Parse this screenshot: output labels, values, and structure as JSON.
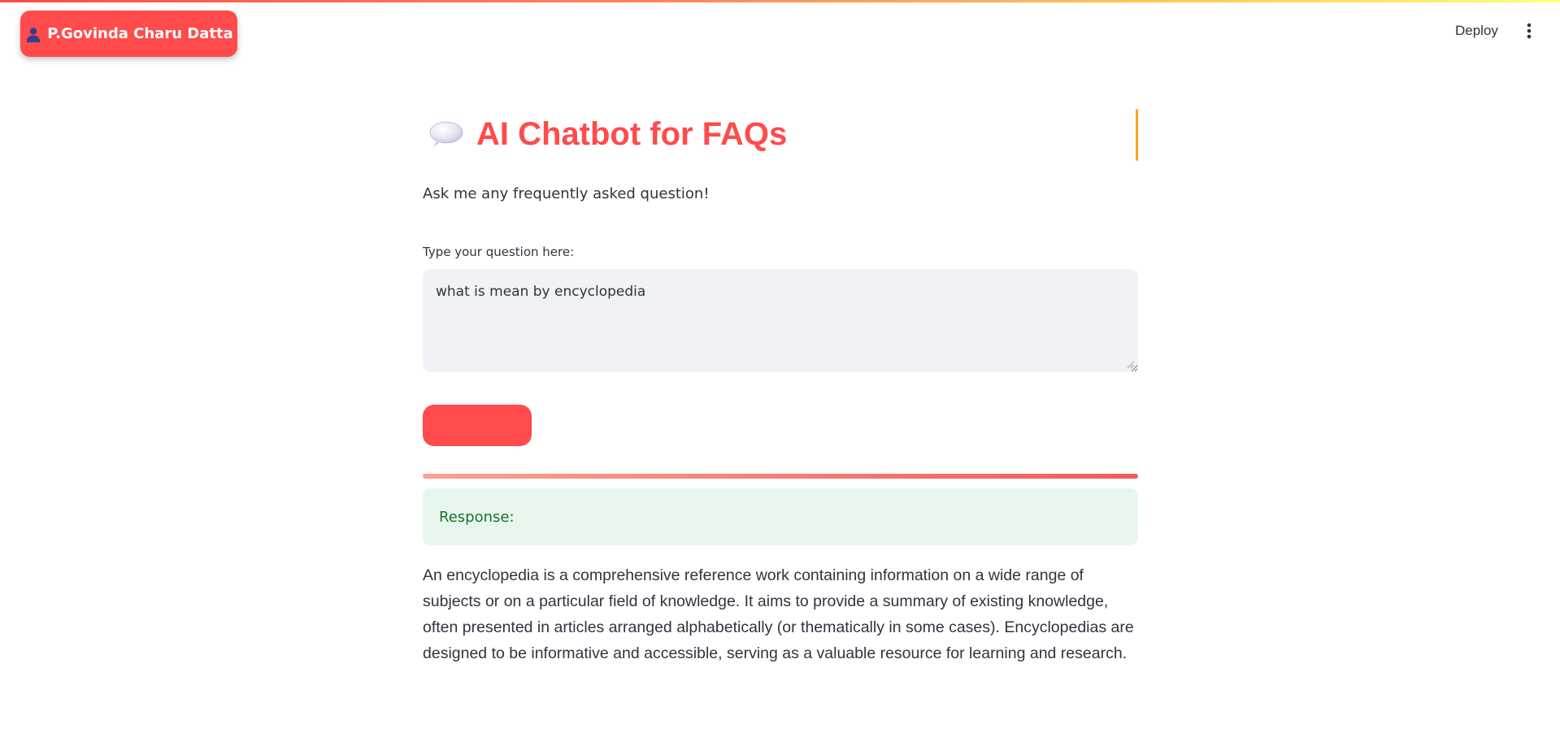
{
  "header": {
    "user_name": "P.Govinda Charu Datta",
    "deploy_label": "Deploy"
  },
  "main": {
    "title": "AI Chatbot for FAQs",
    "subtitle": "Ask me any frequently asked question!",
    "input_label": "Type your question here:",
    "question_value": "what is mean by encyclopedia",
    "submit_label": "",
    "response_label": "Response:",
    "answer": "An encyclopedia is a comprehensive reference work containing information on a wide range of subjects or on a particular field of knowledge. It aims to provide a summary of existing knowledge, often presented in articles arranged alphabetically (or thematically in some cases). Encyclopedias are designed to be informative and accessible, serving as a valuable resource for learning and research."
  },
  "icons": {
    "user": "user-silhouette-icon",
    "chat": "speech-balloon-icon",
    "menu": "kebab-menu-icon"
  },
  "colors": {
    "accent": "#ff4b4b",
    "title_accent_bar": "#ffa421",
    "response_bg": "#e8f7ed",
    "response_text": "#177233",
    "input_bg": "#f0f2f6"
  }
}
